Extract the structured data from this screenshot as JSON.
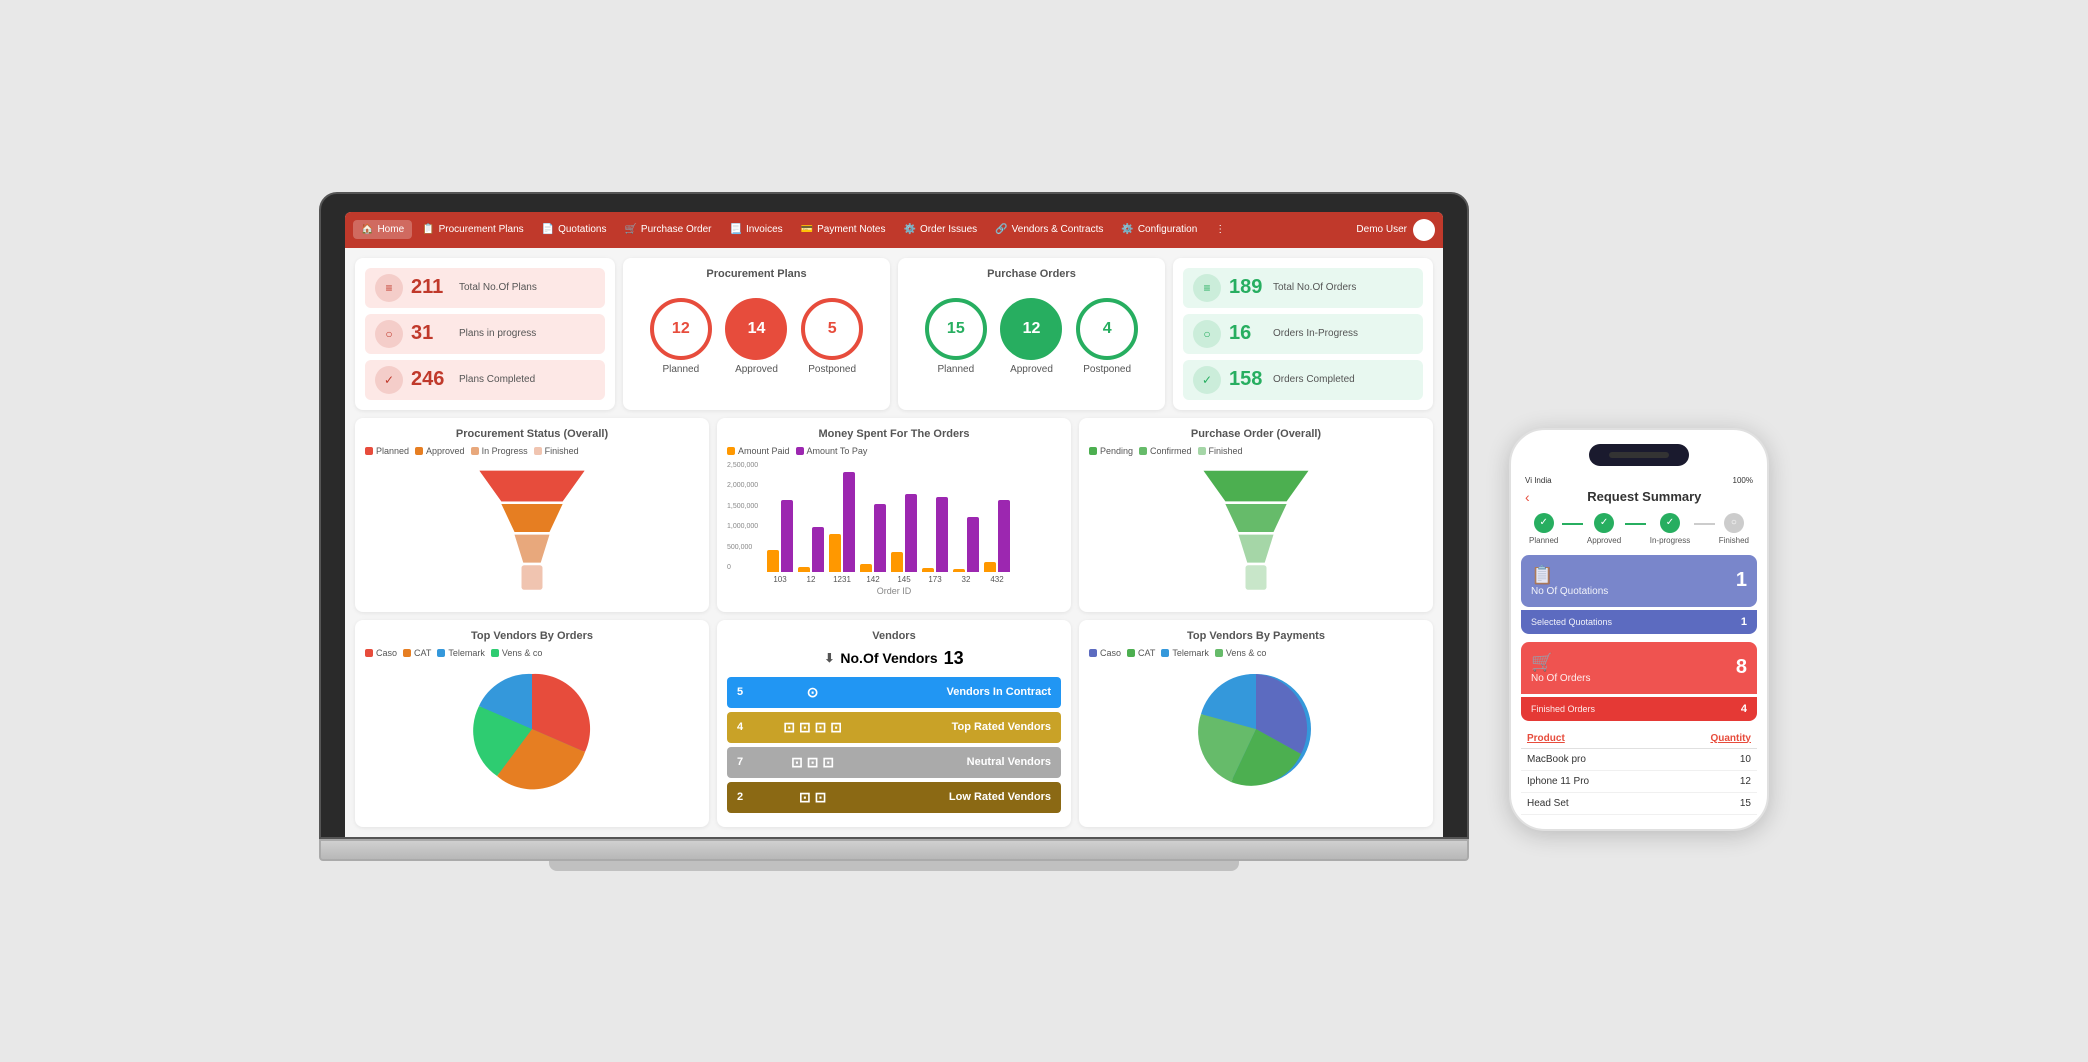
{
  "nav": {
    "items": [
      "Home",
      "Procurement Plans",
      "Quotations",
      "Purchase Order",
      "Invoices",
      "Payment Notes",
      "Order Issues",
      "Vendors & Contracts",
      "Configuration"
    ],
    "user": "Demo User"
  },
  "procurement_plans": {
    "title": "Procurement Plans",
    "stats": {
      "total": {
        "number": "211",
        "label": "Total No.Of Plans"
      },
      "in_progress": {
        "number": "31",
        "label": "Plans in progress"
      },
      "completed": {
        "number": "246",
        "label": "Plans Completed"
      }
    },
    "circles": [
      {
        "number": "12",
        "label": "Planned",
        "type": "red"
      },
      {
        "number": "14",
        "label": "Approved",
        "type": "red-fill"
      },
      {
        "number": "5",
        "label": "Postponed",
        "type": "red"
      }
    ]
  },
  "purchase_orders": {
    "title": "Purchase Orders",
    "stats": {
      "total": {
        "number": "189",
        "label": "Total No.Of Orders"
      },
      "in_progress": {
        "number": "16",
        "label": "Orders In-Progress"
      },
      "completed": {
        "number": "158",
        "label": "Orders Completed"
      }
    },
    "circles": [
      {
        "number": "15",
        "label": "Planned",
        "type": "green"
      },
      {
        "number": "12",
        "label": "Approved",
        "type": "green-fill"
      },
      {
        "number": "4",
        "label": "Postponed",
        "type": "green"
      }
    ]
  },
  "charts": {
    "procurement_status": {
      "title": "Procurement Status (Overall)",
      "legend": [
        "Planned",
        "Approved",
        "In Progress",
        "Finished"
      ]
    },
    "money_spent": {
      "title": "Money Spent For The Orders",
      "legend": [
        "Amount Paid",
        "Amount To Pay"
      ],
      "y_labels": [
        "2,500,000",
        "2,000,000",
        "1,500,000",
        "1,000,000",
        "500,000",
        "0"
      ],
      "x_labels": [
        "103",
        "12",
        "1231",
        "142",
        "145",
        "173",
        "32",
        "432"
      ],
      "x_title": "Order ID"
    },
    "purchase_overall": {
      "title": "Purchase Order (Overall)",
      "legend": [
        "Pending",
        "Confirmed",
        "Finished"
      ]
    }
  },
  "vendors": {
    "title": "Vendors",
    "count_label": "No.Of Vendors",
    "count": "13",
    "rows": [
      {
        "num": "5",
        "label": "Vendors In Contract",
        "color": "#2196F3"
      },
      {
        "num": "4",
        "label": "Top Rated Vendors",
        "color": "#c9a227"
      },
      {
        "num": "7",
        "label": "Neutral Vendors",
        "color": "#aaa"
      },
      {
        "num": "2",
        "label": "Low Rated Vendors",
        "color": "#8B6914"
      }
    ]
  },
  "top_vendors_orders": {
    "title": "Top Vendors By Orders",
    "legend": [
      "Caso",
      "CAT",
      "Telemark",
      "Vens & co"
    ]
  },
  "top_vendors_payments": {
    "title": "Top Vendors By Payments",
    "legend": [
      "Caso",
      "CAT",
      "Telemark",
      "Vens & co"
    ]
  },
  "phone": {
    "title": "Request Summary",
    "status_left": "Vi India",
    "status_right": "100%",
    "steps": [
      "Planned",
      "Approved",
      "In-progress",
      "Finished"
    ],
    "quotations": {
      "label": "No Of Quotations",
      "number": "1",
      "sub_label": "Selected Quotations",
      "sub_number": "1"
    },
    "orders": {
      "label": "No Of Orders",
      "number": "8",
      "sub_label": "Finished Orders",
      "sub_number": "4"
    },
    "product_table": {
      "col1": "Product",
      "col2": "Quantity",
      "rows": [
        {
          "name": "MacBook pro",
          "qty": "10"
        },
        {
          "name": "Iphone 11 Pro",
          "qty": "12"
        },
        {
          "name": "Head Set",
          "qty": "15"
        }
      ]
    }
  },
  "colors": {
    "red": "#c0392b",
    "green": "#27ae60",
    "blue": "#2196F3",
    "gold": "#c9a227",
    "purple_bar": "#9c27b0",
    "orange_bar": "#ff9800"
  }
}
